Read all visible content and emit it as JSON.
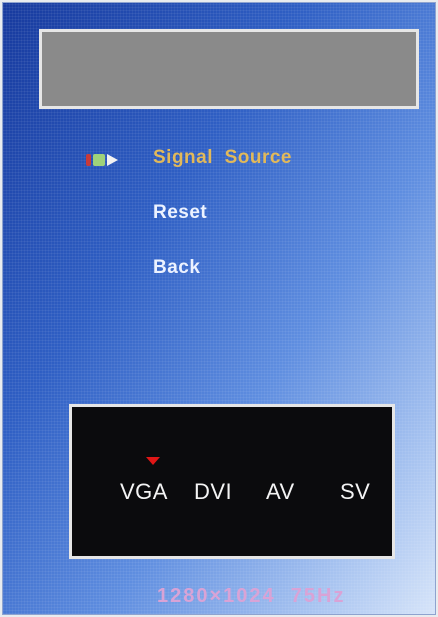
{
  "title_bar": {
    "text": ""
  },
  "menu": {
    "items": [
      {
        "label": "Signal  Source",
        "selected": true
      },
      {
        "label": "Reset",
        "selected": false
      },
      {
        "label": "Back",
        "selected": false
      }
    ],
    "selected_color": "#e2b95a",
    "normal_color": "#ecf2ff"
  },
  "source_panel": {
    "options": [
      "VGA",
      "DVI",
      "AV",
      "SV"
    ],
    "active": "VGA",
    "marker_color": "#e01616"
  },
  "status": {
    "resolution": "1280×1024  75Hz"
  },
  "icons": {
    "selector": "selector-pointer-icon",
    "marker": "triangle-down-icon"
  }
}
